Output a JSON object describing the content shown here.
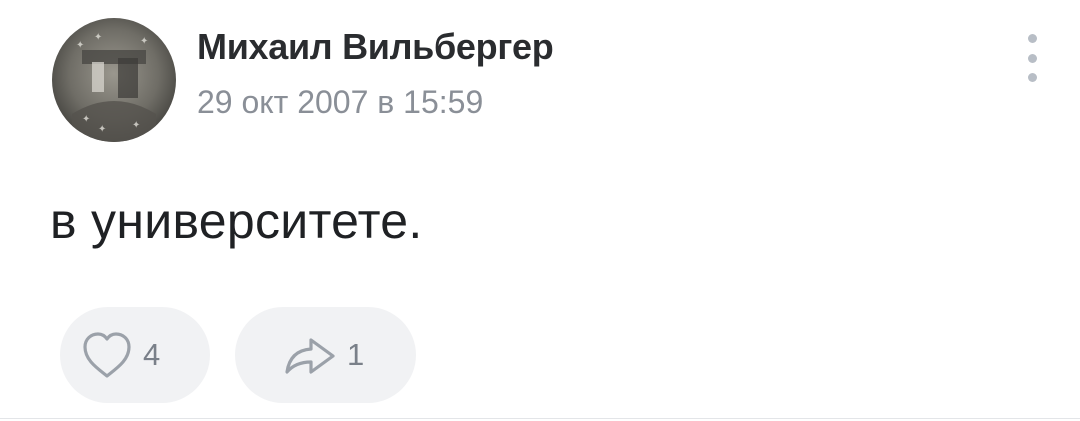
{
  "post": {
    "author": "Михаил Вильбергер",
    "date": "29 окт 2007 в 15:59",
    "text": "в университете.",
    "avatar_icon": "avatar-photo",
    "more_icon": "more-vertical-icon",
    "likes": {
      "icon": "heart-icon",
      "count": "4"
    },
    "shares": {
      "icon": "share-arrow-icon",
      "count": "1"
    }
  },
  "colors": {
    "author_text": "#2a2c2f",
    "secondary_text": "#8a8f97",
    "button_bg": "#f1f2f4",
    "icon_gray": "#9ba1a9",
    "divider": "#e3e5e8"
  }
}
